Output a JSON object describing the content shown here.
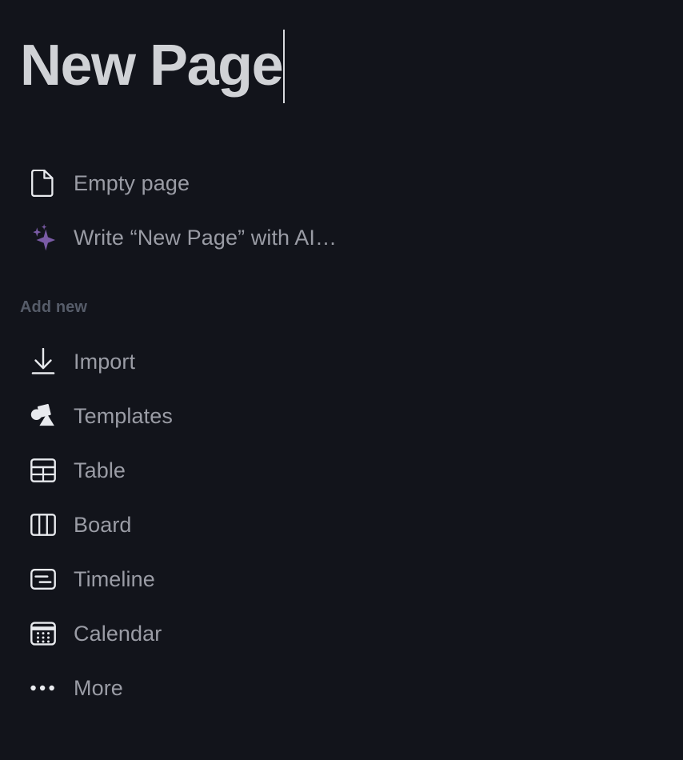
{
  "title": {
    "text": "New Page",
    "color": "#d0d2d6",
    "caret_visible": true
  },
  "colors": {
    "background": "#12141b",
    "title_text": "#d0d2d6",
    "item_text": "#9a9ca5",
    "section_label": "#565c69",
    "icon": "#e8eaee",
    "ai_accent": "#7a5ba6"
  },
  "primary_options": [
    {
      "label": "Empty page",
      "icon": "document-icon"
    },
    {
      "label": "Write “New Page” with AI…",
      "icon": "ai-sparkle-icon"
    }
  ],
  "add_new": {
    "section_label": "Add new",
    "items": [
      {
        "label": "Import",
        "icon": "download-arrow-icon"
      },
      {
        "label": "Templates",
        "icon": "shapes-icon"
      },
      {
        "label": "Table",
        "icon": "table-grid-icon"
      },
      {
        "label": "Board",
        "icon": "board-columns-icon"
      },
      {
        "label": "Timeline",
        "icon": "timeline-bars-icon"
      },
      {
        "label": "Calendar",
        "icon": "calendar-icon"
      },
      {
        "label": "More",
        "icon": "ellipsis-icon"
      }
    ]
  }
}
